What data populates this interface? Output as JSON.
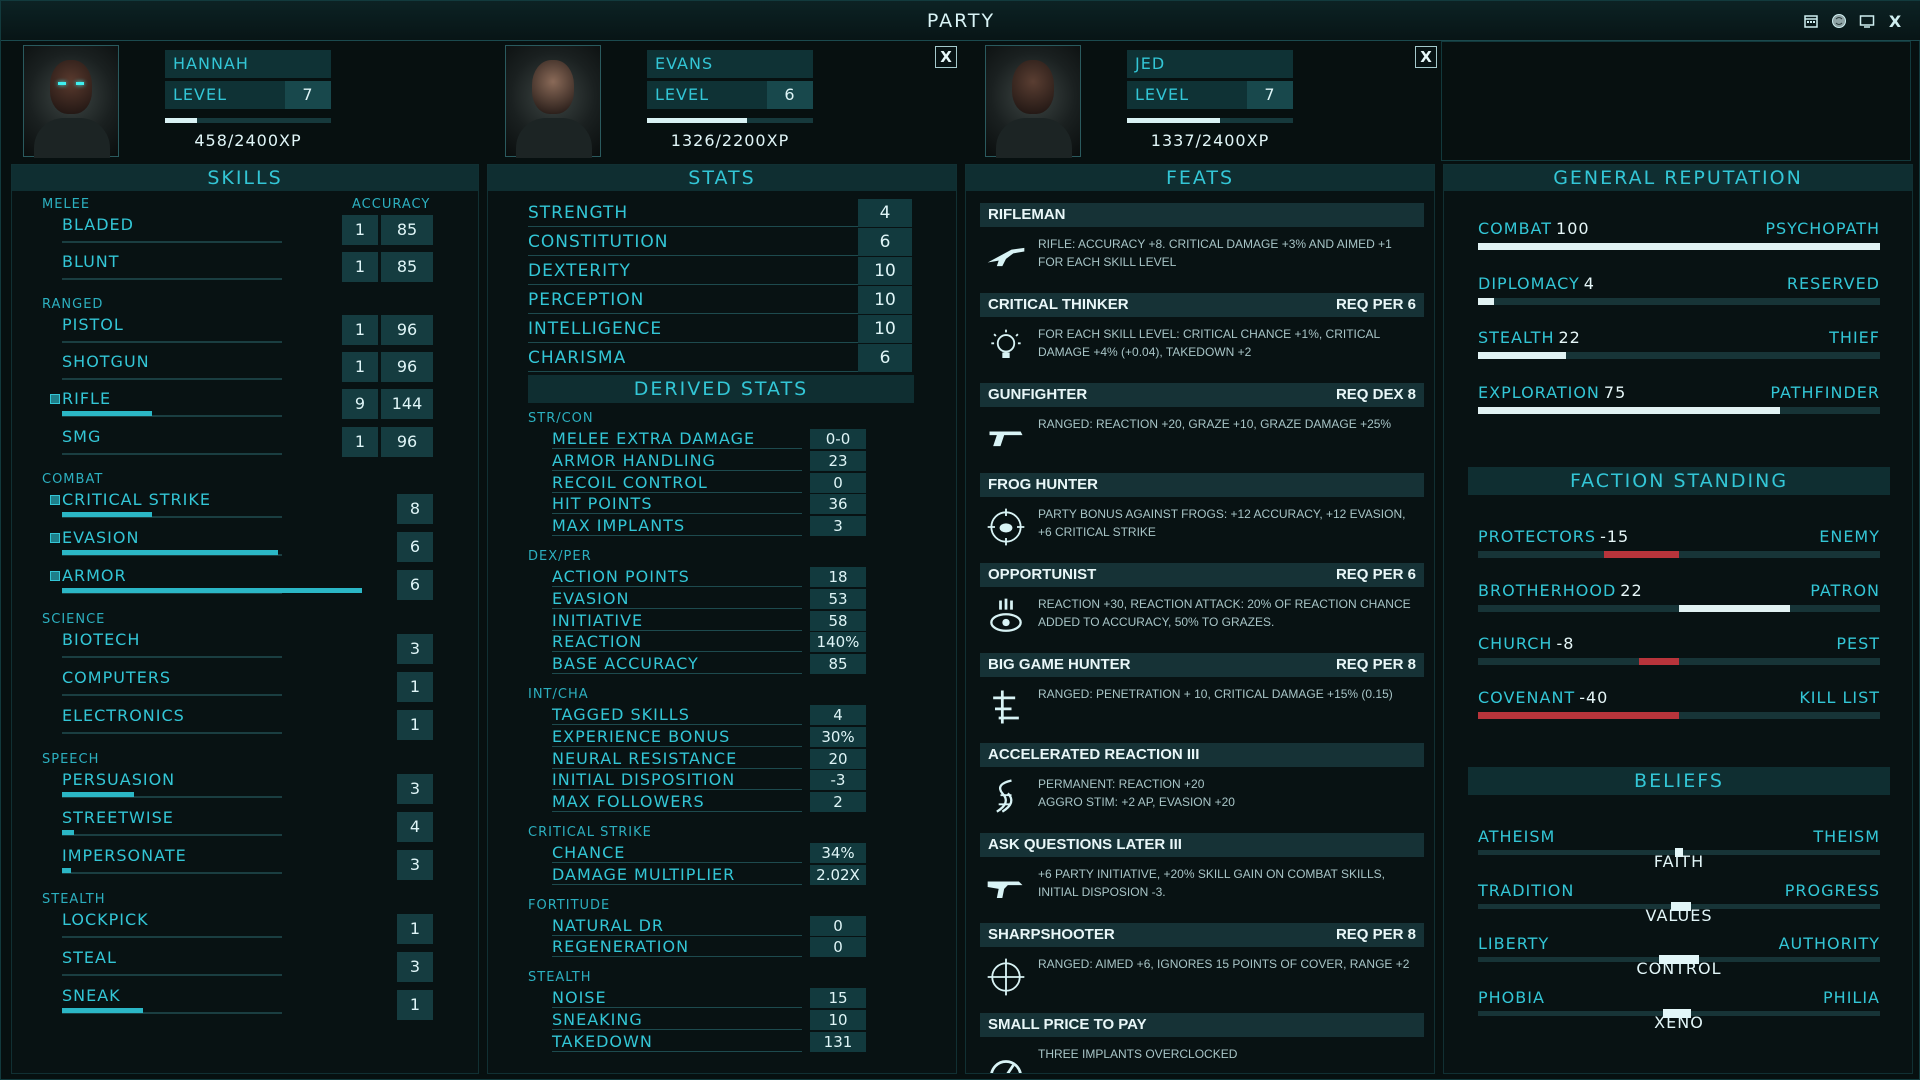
{
  "window": {
    "title": "PARTY",
    "icons": [
      "calendar-icon",
      "brain-icon",
      "screen-icon",
      "close-icon"
    ],
    "close_glyph": "X"
  },
  "characters": [
    {
      "name": "HANNAH",
      "level_label": "LEVEL",
      "level": "7",
      "xp": "458/2400XP",
      "xp_fraction": 0.19,
      "closable": false,
      "skin": "#5a3a2e",
      "eyes": "#3ff0f0"
    },
    {
      "name": "EVANS",
      "level_label": "LEVEL",
      "level": "6",
      "xp": "1326/2200XP",
      "xp_fraction": 0.6,
      "closable": true,
      "close": "X",
      "skin": "#8a6a58"
    },
    {
      "name": "JED",
      "level_label": "LEVEL",
      "level": "7",
      "xp": "1337/2400XP",
      "xp_fraction": 0.56,
      "closable": true,
      "close": "X",
      "skin": "#5a3e32"
    }
  ],
  "skills": {
    "title": "SKILLS",
    "groups": [
      {
        "name": "MELEE",
        "right_header": "ACCURACY",
        "items": [
          {
            "name": "BLADED",
            "level": "1",
            "accuracy": "85"
          },
          {
            "name": "BLUNT",
            "level": "1",
            "accuracy": "85"
          }
        ]
      },
      {
        "name": "RANGED",
        "items": [
          {
            "name": "PISTOL",
            "level": "1",
            "accuracy": "96"
          },
          {
            "name": "SHOTGUN",
            "level": "1",
            "accuracy": "96"
          },
          {
            "name": "RIFLE",
            "level": "9",
            "accuracy": "144",
            "tagged": true,
            "progress": 0.3
          },
          {
            "name": "SMG",
            "level": "1",
            "accuracy": "96"
          }
        ]
      },
      {
        "name": "COMBAT",
        "items": [
          {
            "name": "CRITICAL STRIKE",
            "level": "8",
            "tagged": true,
            "progress": 0.3
          },
          {
            "name": "EVASION",
            "level": "6",
            "tagged": true,
            "progress": 0.72
          },
          {
            "name": "ARMOR",
            "level": "6",
            "tagged": true,
            "progress": 1.0
          }
        ]
      },
      {
        "name": "SCIENCE",
        "items": [
          {
            "name": "BIOTECH",
            "level": "3"
          },
          {
            "name": "COMPUTERS",
            "level": "1"
          },
          {
            "name": "ELECTRONICS",
            "level": "1"
          }
        ]
      },
      {
        "name": "SPEECH",
        "items": [
          {
            "name": "PERSUASION",
            "level": "3",
            "progress": 0.24
          },
          {
            "name": "STREETWISE",
            "level": "4",
            "progress": 0.04
          },
          {
            "name": "IMPERSONATE",
            "level": "3",
            "progress": 0.03
          }
        ]
      },
      {
        "name": "STEALTH",
        "items": [
          {
            "name": "LOCKPICK",
            "level": "1"
          },
          {
            "name": "STEAL",
            "level": "3"
          },
          {
            "name": "SNEAK",
            "level": "1",
            "progress": 0.27
          }
        ]
      }
    ]
  },
  "stats": {
    "title": "STATS",
    "items": [
      {
        "name": "STRENGTH",
        "value": "4"
      },
      {
        "name": "CONSTITUTION",
        "value": "6"
      },
      {
        "name": "DEXTERITY",
        "value": "10"
      },
      {
        "name": "PERCEPTION",
        "value": "10"
      },
      {
        "name": "INTELLIGENCE",
        "value": "10"
      },
      {
        "name": "CHARISMA",
        "value": "6"
      }
    ],
    "derived_title": "DERIVED STATS",
    "derived": [
      {
        "name": "STR/CON",
        "items": [
          {
            "name": "MELEE EXTRA DAMAGE",
            "value": "0-0"
          },
          {
            "name": "ARMOR HANDLING",
            "value": "23"
          },
          {
            "name": "RECOIL CONTROL",
            "value": "0"
          },
          {
            "name": "HIT POINTS",
            "value": "36"
          },
          {
            "name": "MAX IMPLANTS",
            "value": "3"
          }
        ]
      },
      {
        "name": "DEX/PER",
        "items": [
          {
            "name": "ACTION POINTS",
            "value": "18"
          },
          {
            "name": "EVASION",
            "value": "53"
          },
          {
            "name": "INITIATIVE",
            "value": "58"
          },
          {
            "name": "REACTION",
            "value": "140%"
          },
          {
            "name": "BASE ACCURACY",
            "value": "85"
          }
        ]
      },
      {
        "name": "INT/CHA",
        "items": [
          {
            "name": "TAGGED SKILLS",
            "value": "4"
          },
          {
            "name": "EXPERIENCE BONUS",
            "value": "30%"
          },
          {
            "name": "NEURAL RESISTANCE",
            "value": "20"
          },
          {
            "name": "INITIAL DISPOSITION",
            "value": "-3"
          },
          {
            "name": "MAX FOLLOWERS",
            "value": "2"
          }
        ]
      },
      {
        "name": "CRITICAL STRIKE",
        "items": [
          {
            "name": "CHANCE",
            "value": "34%"
          },
          {
            "name": "DAMAGE MULTIPLIER",
            "value": "2.02x"
          }
        ]
      },
      {
        "name": "FORTITUDE",
        "items": [
          {
            "name": "NATURAL DR",
            "value": "0"
          },
          {
            "name": "REGENERATION",
            "value": "0"
          }
        ]
      },
      {
        "name": "STEALTH",
        "items": [
          {
            "name": "NOISE",
            "value": "15"
          },
          {
            "name": "SNEAKING",
            "value": "10"
          },
          {
            "name": "TAKEDOWN",
            "value": "131"
          }
        ]
      }
    ]
  },
  "feats": {
    "title": "FEATS",
    "items": [
      {
        "name": "RIFLEMAN",
        "req": "",
        "icon": "rifle-icon",
        "desc": "RIFLE: ACCURACY +8. CRITICAL DAMAGE +3% AND AIMED +1 FOR EACH SKILL LEVEL"
      },
      {
        "name": "CRITICAL THINKER",
        "req": "REQ PER 6",
        "icon": "lightbulb-icon",
        "desc": "FOR EACH SKILL LEVEL: CRITICAL CHANCE +1%, CRITICAL DAMAGE +4% (+0.04), TAKEDOWN +2"
      },
      {
        "name": "GUNFIGHTER",
        "req": "REQ DEX 8",
        "icon": "pistol-icon",
        "desc": "RANGED: REACTION +20, GRAZE +10, GRAZE DAMAGE +25%"
      },
      {
        "name": "FROG HUNTER",
        "req": "",
        "icon": "frog-target-icon",
        "desc": "PARTY BONUS AGAINST FROGS: +12 ACCURACY, +12 EVASION, +6 CRITICAL STRIKE"
      },
      {
        "name": "OPPORTUNIST",
        "req": "REQ PER 6",
        "icon": "eye-alert-icon",
        "desc": "REACTION +30, REACTION ATTACK: 20% OF REACTION CHANCE ADDED TO ACCURACY, 50% TO GRAZES."
      },
      {
        "name": "BIG GAME HUNTER",
        "req": "REQ PER 8",
        "icon": "hunter-icon",
        "desc": "RANGED: PENETRATION + 10, CRITICAL DAMAGE +15% (0.15)"
      },
      {
        "name": "ACCELERATED REACTION III",
        "req": "",
        "icon": "dna-icon",
        "desc": "PERMANENT: REACTION +20\nAGGRO STIM: +2 AP, EVASION +20"
      },
      {
        "name": "ASK QUESTIONS LATER III",
        "req": "",
        "icon": "smg-icon",
        "desc": "+6 PARTY INITIATIVE, +20% SKILL GAIN ON COMBAT SKILLS, INITIAL DISPOSION -3."
      },
      {
        "name": "SHARPSHOOTER",
        "req": "REQ PER 8",
        "icon": "crosshair-icon",
        "desc": "RANGED: AIMED +6, IGNORES 15 POINTS OF COVER, RANGE +2"
      },
      {
        "name": "SMALL PRICE TO PAY",
        "req": "",
        "icon": "gauge-icon",
        "desc": "THREE IMPLANTS OVERCLOCKED"
      }
    ]
  },
  "reputation": {
    "title": "GENERAL REPUTATION",
    "items": [
      {
        "name": "COMBAT",
        "value": "100",
        "rank": "PSYCHOPATH",
        "fraction": 1.0
      },
      {
        "name": "DIPLOMACY",
        "value": "4",
        "rank": "RESERVED",
        "fraction": 0.04
      },
      {
        "name": "STEALTH",
        "value": "22",
        "rank": "THIEF",
        "fraction": 0.22
      },
      {
        "name": "EXPLORATION",
        "value": "75",
        "rank": "PATHFINDER",
        "fraction": 0.75
      }
    ]
  },
  "factions": {
    "title": "FACTION STANDING",
    "items": [
      {
        "name": "PROTECTORS",
        "value": "-15",
        "rank": "ENEMY",
        "standing": -15
      },
      {
        "name": "BROTHERHOOD",
        "value": "22",
        "rank": "PATRON",
        "standing": 22
      },
      {
        "name": "CHURCH",
        "value": "-8",
        "rank": "PEST",
        "standing": -8
      },
      {
        "name": "COVENANT",
        "value": "-40",
        "rank": "KILL LIST",
        "standing": -40
      }
    ]
  },
  "beliefs": {
    "title": "BELIEFS",
    "items": [
      {
        "left": "ATHEISM",
        "right": "THEISM",
        "label": "FAITH",
        "position": 0.49,
        "spread": 0.02
      },
      {
        "left": "TRADITION",
        "right": "PROGRESS",
        "label": "VALUES",
        "position": 0.48,
        "spread": 0.05
      },
      {
        "left": "LIBERTY",
        "right": "AUTHORITY",
        "label": "CONTROL",
        "position": 0.45,
        "spread": 0.1
      },
      {
        "left": "PHOBIA",
        "right": "PHILIA",
        "label": "XENO",
        "position": 0.46,
        "spread": 0.07
      }
    ]
  },
  "colors": {
    "accent": "#33c6d6",
    "value": "#dff5f7",
    "negative": "#b8343b",
    "background": "#071010"
  }
}
